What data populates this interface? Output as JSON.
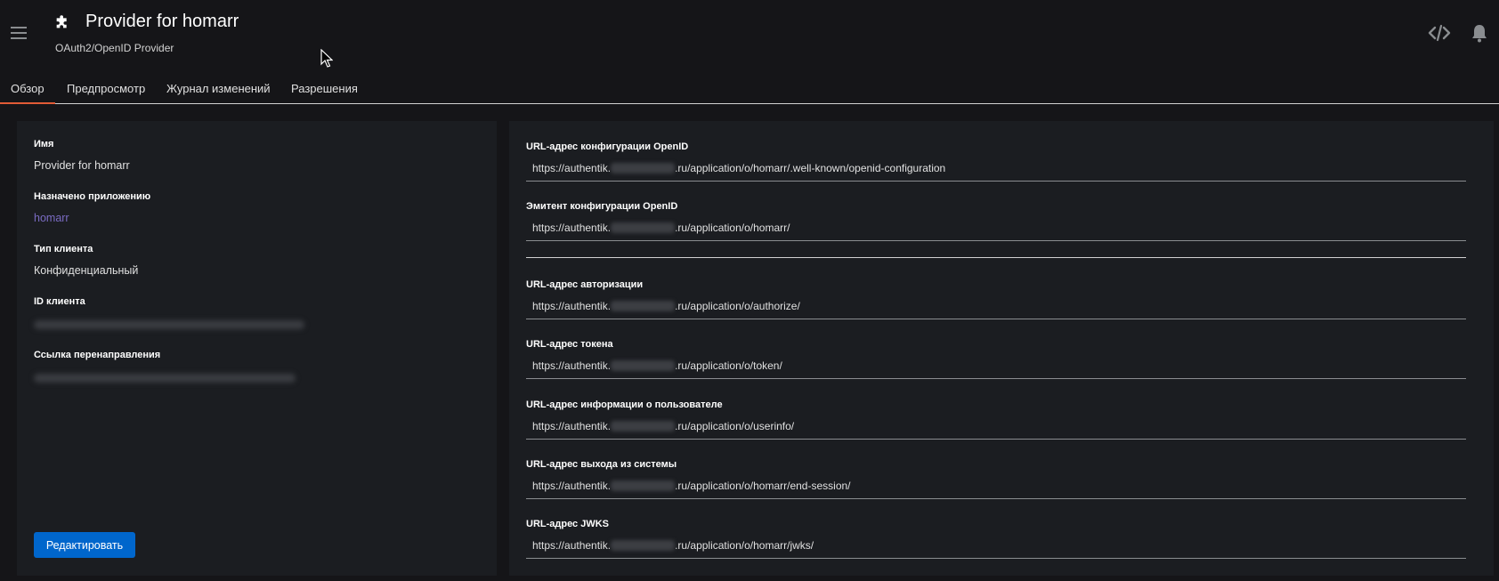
{
  "header": {
    "title": "Provider for homarr",
    "subtitle": "OAuth2/OpenID Provider",
    "icons": {
      "menu": "hamburger-menu-icon",
      "title": "puzzle-icon",
      "code": "code-icon",
      "notifications": "bell-icon"
    }
  },
  "tabs": [
    {
      "label": "Обзор",
      "active": true
    },
    {
      "label": "Предпросмотр",
      "active": false
    },
    {
      "label": "Журнал изменений",
      "active": false
    },
    {
      "label": "Разрешения",
      "active": false
    }
  ],
  "details": {
    "name_label": "Имя",
    "name_value": "Provider for homarr",
    "assigned_label": "Назначено приложению",
    "assigned_value": "homarr",
    "client_type_label": "Тип клиента",
    "client_type_value": "Конфиденциальный",
    "client_id_label": "ID клиента",
    "redirect_label": "Ссылка перенаправления",
    "edit_label": "Редактировать"
  },
  "urls": [
    {
      "label": "URL-адрес конфигурации OpenID",
      "prefix": "https://authentik.",
      "suffix": ".ru/application/o/homarr/.well-known/openid-configuration"
    },
    {
      "label": "Эмитент конфигурации OpenID",
      "prefix": "https://authentik.",
      "suffix": ".ru/application/o/homarr/"
    },
    {
      "label": "URL-адрес авторизации",
      "prefix": "https://authentik.",
      "suffix": ".ru/application/o/authorize/"
    },
    {
      "label": "URL-адрес токена",
      "prefix": "https://authentik.",
      "suffix": ".ru/application/o/token/"
    },
    {
      "label": "URL-адрес информации о пользователе",
      "prefix": "https://authentik.",
      "suffix": ".ru/application/o/userinfo/"
    },
    {
      "label": "URL-адрес выхода из системы",
      "prefix": "https://authentik.",
      "suffix": ".ru/application/o/homarr/end-session/"
    },
    {
      "label": "URL-адрес JWKS",
      "prefix": "https://authentik.",
      "suffix": ".ru/application/o/homarr/jwks/"
    }
  ],
  "colors": {
    "accent": "#e25b36",
    "primary": "#0066cc",
    "link": "#7a6bc2",
    "background": "#151518",
    "card": "#1b1d21"
  }
}
